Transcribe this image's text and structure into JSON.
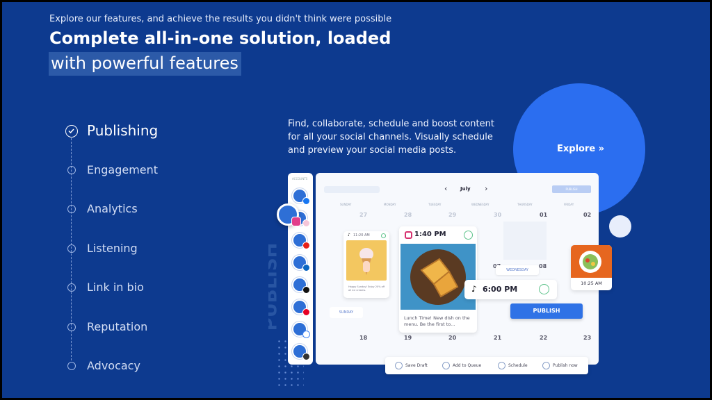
{
  "hero": {
    "eyebrow": "Explore our features, and achieve the results you didn't think were possible",
    "headline_line1": "Complete all-in-one solution, loaded",
    "headline_line2": "with powerful features"
  },
  "features": [
    {
      "label": "Publishing",
      "active": true
    },
    {
      "label": "Engagement",
      "active": false
    },
    {
      "label": "Analytics",
      "active": false
    },
    {
      "label": "Listening",
      "active": false
    },
    {
      "label": "Link in bio",
      "active": false
    },
    {
      "label": "Reputation",
      "active": false
    },
    {
      "label": "Advocacy",
      "active": false
    }
  ],
  "description": "Find, collaborate, schedule and boost content for all your social channels. Visually schedule and preview your social media posts.",
  "explore_link": "Explore »",
  "mockup": {
    "social_column_title": "ACCOUNTS",
    "watermark": "PUBLISH",
    "calendar": {
      "month": "July",
      "publish_mini": "PUBLISH",
      "days": [
        "SUNDAY",
        "MONDAY",
        "TUESDAY",
        "WEDNESDAY",
        "THURSDAY",
        "FRIDAY"
      ],
      "week1_dates": [
        "27",
        "28",
        "29",
        "30",
        "01",
        "02"
      ],
      "row2_dates": [
        "07",
        "08"
      ],
      "week3_dates": [
        "18",
        "19",
        "20",
        "21",
        "22",
        "23"
      ]
    },
    "small_post": {
      "time": "11:20 AM",
      "caption": "Happy Sunday! Enjoy 20% off all ice creams."
    },
    "instagram_post": {
      "time": "1:40 PM",
      "caption": "Lunch Time! New dish on the menu. Be the first to..."
    },
    "tiktok_post": {
      "time": "6:00 PM"
    },
    "food_post": {
      "time": "10:25 AM"
    },
    "wednesday_tag": "WEDNESDAY",
    "sunday_tag": "SUNDAY",
    "publish_button": "PUBLISH",
    "actions": [
      "Save Draft",
      "Add to Queue",
      "Schedule",
      "Publish now"
    ]
  },
  "colors": {
    "background": "#0d3a8f",
    "accent": "#2b6ef0",
    "publish_button": "#2f72e6"
  },
  "icons": {
    "active_feature": "check-circle-icon",
    "channels": [
      "facebook-icon",
      "instagram-icon",
      "youtube-icon",
      "linkedin-icon",
      "tiktok-icon",
      "pinterest-icon",
      "google-icon",
      "threads-icon"
    ]
  }
}
